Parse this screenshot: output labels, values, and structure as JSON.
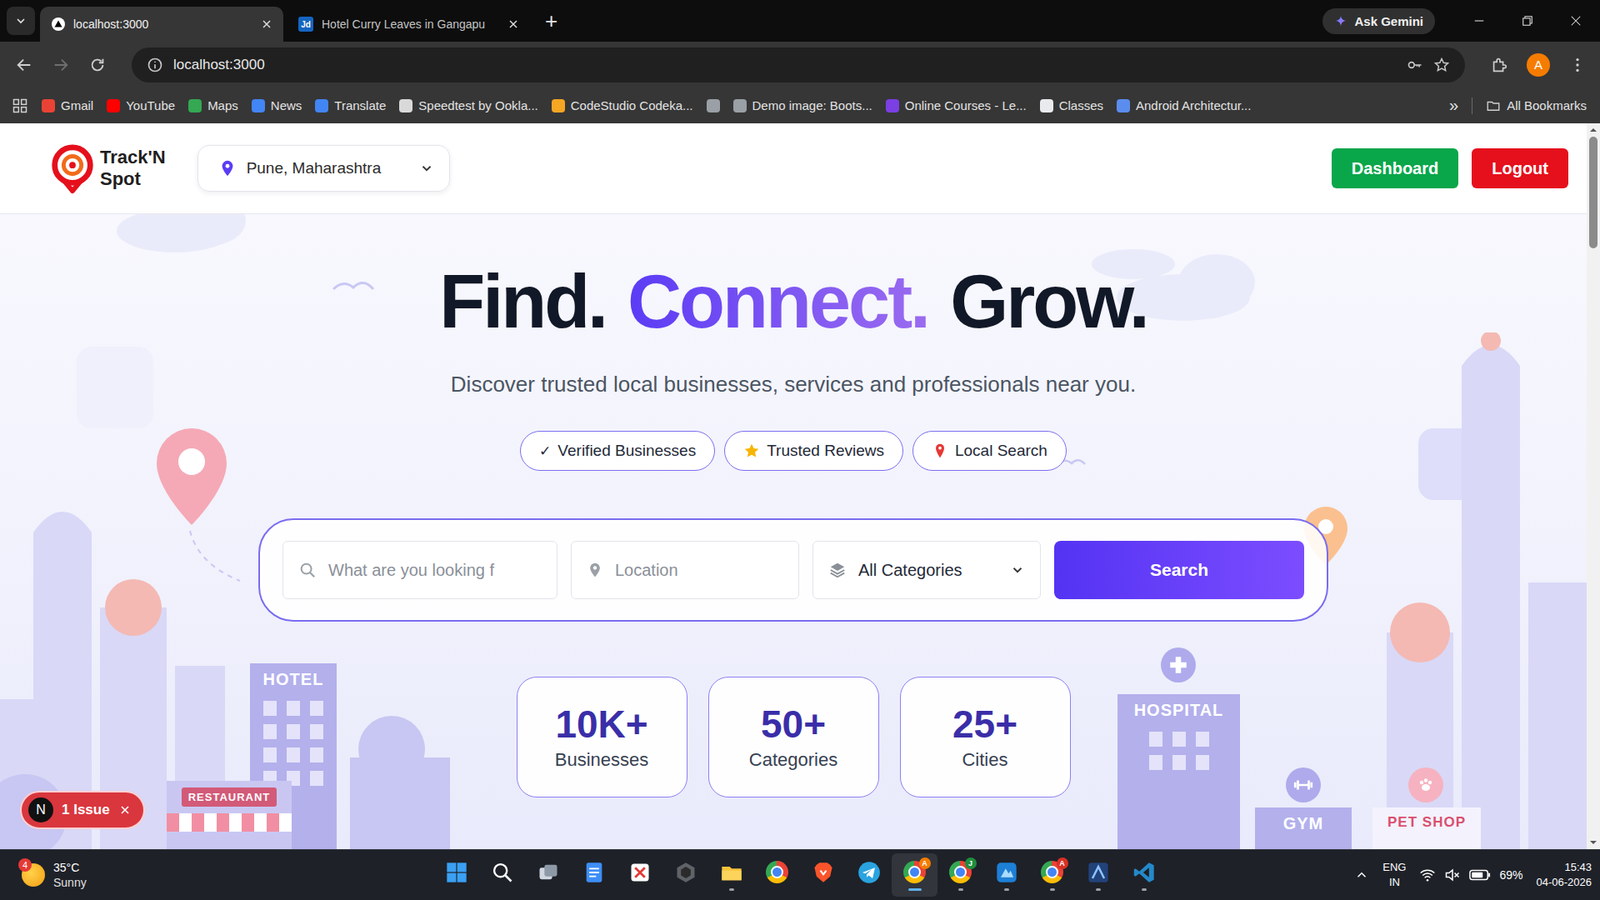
{
  "browser": {
    "tabs": [
      {
        "title": "localhost:3000",
        "selected": true,
        "kind": "next"
      },
      {
        "title": "Hotel Curry Leaves in Gangapu",
        "selected": false,
        "kind": "letters",
        "favicon": "Jd"
      }
    ],
    "new_tab": "+",
    "gemini": "Ask Gemini",
    "nav": {
      "back_enabled": true,
      "forward_enabled": false
    },
    "address": "localhost:3000",
    "profile": "A",
    "bookmarks": [
      {
        "label": "Gmail",
        "color": "#ea4335"
      },
      {
        "label": "YouTube",
        "color": "#ff0000"
      },
      {
        "label": "Maps",
        "color": "#34a853"
      },
      {
        "label": "News",
        "color": "#4285f4"
      },
      {
        "label": "Translate",
        "color": "#4285f4"
      },
      {
        "label": "Speedtest by Ookla...",
        "color": "#d9d9d9"
      },
      {
        "label": "CodeStudio Codeka...",
        "color": "#f5a623"
      },
      {
        "label": "",
        "color": "#9aa0a6"
      },
      {
        "label": "Demo image: Boots...",
        "color": "#9aa0a6"
      },
      {
        "label": "Online Courses - Le...",
        "color": "#7b3fe4"
      },
      {
        "label": "Classes",
        "color": "#e8eaed"
      },
      {
        "label": "Android Architectur...",
        "color": "#5b8def"
      }
    ],
    "more": "»",
    "all_bookmarks": "All Bookmarks"
  },
  "site": {
    "logo": {
      "line1": "Track'N",
      "line2": "Spot"
    },
    "location": "Pune, Maharashtra",
    "buttons": [
      {
        "label": "Dashboard",
        "color": "#0aa64a"
      },
      {
        "label": "Logout",
        "color": "#e5101c"
      }
    ]
  },
  "hero": {
    "title": [
      {
        "text": "Find.",
        "accent": false
      },
      {
        "text": "Connect.",
        "accent": true
      },
      {
        "text": "Grow.",
        "accent": false
      }
    ],
    "subtitle": "Discover trusted local businesses, services and professionals near you.",
    "chips": [
      {
        "kind": "check",
        "glyph": "✓",
        "label": "Verified Businesses"
      },
      {
        "kind": "star",
        "label": "Trusted Reviews"
      },
      {
        "kind": "pin",
        "label": "Local Search"
      }
    ]
  },
  "search": {
    "query_placeholder": "What are you looking f",
    "location_placeholder": "Location",
    "category": "All Categories",
    "button": "Search"
  },
  "stats": [
    {
      "value": "10K+",
      "label": "Businesses"
    },
    {
      "value": "50+",
      "label": "Categories"
    },
    {
      "value": "25+",
      "label": "Cities"
    }
  ],
  "illustration": {
    "hotel": "HOTEL",
    "restaurant": "RESTAURANT",
    "hospital": "HOSPITAL",
    "gym": "GYM",
    "pet_shop": "PET SHOP"
  },
  "dev_badge": {
    "logo": "N",
    "label": "1 Issue"
  },
  "scrollbar": {
    "level": 0,
    "thumb": 0.16
  },
  "taskbar": {
    "weather": {
      "badge": "4",
      "temp": "35°C",
      "condition": "Sunny"
    },
    "apps": [
      {
        "kind": "start",
        "running": false,
        "selected": false
      },
      {
        "kind": "search",
        "running": false,
        "selected": false
      },
      {
        "kind": "taskview",
        "running": false,
        "selected": false
      },
      {
        "kind": "notepad",
        "running": false,
        "selected": false
      },
      {
        "kind": "snip",
        "running": false,
        "selected": false
      },
      {
        "kind": "hex",
        "running": false,
        "selected": false
      },
      {
        "kind": "explorer",
        "running": true,
        "selected": false
      },
      {
        "kind": "chrome",
        "running": false,
        "selected": false
      },
      {
        "kind": "brave",
        "running": false,
        "selected": false
      },
      {
        "kind": "telegram",
        "running": false,
        "selected": false
      },
      {
        "kind": "chrome",
        "running": true,
        "selected": true,
        "badge": "A",
        "badge_color": "#f57c00"
      },
      {
        "kind": "chrome",
        "running": true,
        "selected": false,
        "badge": "J",
        "badge_color": "#1e8e3e"
      },
      {
        "kind": "blue",
        "running": true,
        "selected": false
      },
      {
        "kind": "chrome",
        "running": true,
        "selected": false,
        "badge": "A",
        "badge_color": "#d93025"
      },
      {
        "kind": "azure",
        "running": true,
        "selected": false
      },
      {
        "kind": "vscode",
        "running": true,
        "selected": false
      }
    ],
    "tray": {
      "lang": "ENG",
      "region": "IN",
      "battery": "69%",
      "time": "15:43",
      "date": "04-06-2026"
    }
  }
}
